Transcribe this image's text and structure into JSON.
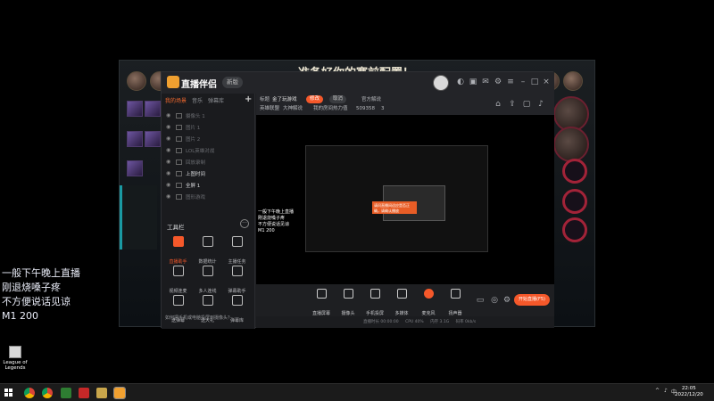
{
  "game_window": {
    "banner": "准备好你的赛前配置！"
  },
  "overlay": {
    "lines": [
      "一般下午晚上直播",
      "刚退烧嗓子疼",
      "不方便说话见谅",
      "M1 200"
    ]
  },
  "desktop": {
    "icon_label_1": "League of",
    "icon_label_2": "Legends"
  },
  "app": {
    "name": "直播伴侣",
    "version": "新版",
    "tabs": [
      "我的场景",
      "音乐",
      "弹幕库"
    ],
    "scenes": [
      {
        "label": "摄像头 1",
        "on": false
      },
      {
        "label": "图片 1",
        "on": false
      },
      {
        "label": "图片 2",
        "on": false
      },
      {
        "label": "LOL英雄对战",
        "on": false
      },
      {
        "label": "回放录制",
        "on": false
      },
      {
        "label": "上图时间",
        "on": true
      },
      {
        "label": "全屏 1",
        "on": true
      },
      {
        "label": "图形游戏",
        "on": false
      }
    ],
    "tools_title": "工具栏",
    "tools": [
      {
        "label": "直播助手",
        "hot": true
      },
      {
        "label": "数据统计",
        "hot": false
      },
      {
        "label": "主播任务",
        "hot": false
      },
      {
        "label": "视频连麦",
        "hot": false
      },
      {
        "label": "多人连线",
        "hot": false
      },
      {
        "label": "弹幕助手",
        "hot": false
      },
      {
        "label": "送弹幕",
        "hot": false
      },
      {
        "label": "送大礼",
        "hot": false
      },
      {
        "label": "弹幕库",
        "hot": false
      },
      {
        "label": "美颜",
        "hot": false
      },
      {
        "label": "PK",
        "hot": false
      },
      {
        "label": "特效",
        "hot": false
      }
    ],
    "footer_tip": "如何把手机或电脑投屏到摄像头？",
    "top": {
      "title_label": "标题",
      "title_value": "金了玩游戏",
      "edit_pill": "修改",
      "category_pill": "取消",
      "room_label": "官方解说",
      "game_label": "英雄联盟",
      "tag_label": "大神解说",
      "hot_label": "我的房间热力值",
      "hot_value": "509358",
      "fans_value": "3"
    },
    "preview_note": [
      "一般下午晚上直播",
      "刚退烧嗓子疼",
      "不方便说话见谅",
      "M1 200"
    ],
    "nested_banner": "准备好你的赛前配置！",
    "nested_orange": "请问直播间适应是否正确，请确认播放",
    "bottom": [
      {
        "label": "直播屏幕"
      },
      {
        "label": "摄像头"
      },
      {
        "label": "手机投屏"
      },
      {
        "label": "多媒体"
      },
      {
        "label": "麦克风"
      },
      {
        "label": "扬声器"
      }
    ],
    "start_button": "开始直播(F5)",
    "status": [
      "直播时长 00:00:00",
      "CPU 40%",
      "内存 3.1G",
      "码率 0kb/s",
      "FPS 60",
      "丢帧 0.00%",
      "帧率 30"
    ]
  },
  "taskbar": {
    "tray_lang": "中",
    "time": "22:05",
    "date": "2022/12/20"
  }
}
